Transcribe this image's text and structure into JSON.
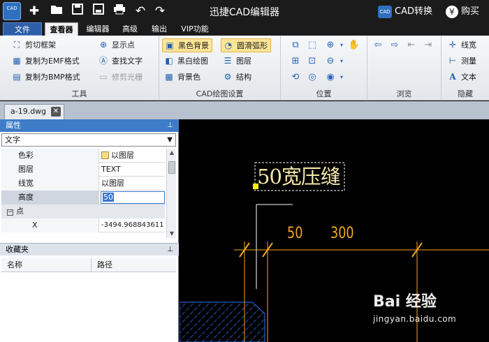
{
  "titlebar": {
    "app_logo": "CAD",
    "title": "迅捷CAD编辑器",
    "cad_convert_label": "CAD转换",
    "cad_convert_badge": "CAD",
    "buy_symbol": "¥",
    "buy_label": "购买",
    "quick_access_icons": [
      "new-icon",
      "open-icon",
      "save-icon",
      "save-as-icon",
      "print-icon",
      "undo-icon",
      "redo-icon"
    ]
  },
  "menu": {
    "tabs": [
      {
        "label": "文件"
      },
      {
        "label": "查看器"
      },
      {
        "label": "编辑器"
      },
      {
        "label": "高级"
      },
      {
        "label": "输出"
      },
      {
        "label": "VIP功能"
      }
    ],
    "active_tab": "查看器"
  },
  "ribbon": {
    "tools": {
      "label": "工具",
      "buttons": [
        "剪切框架",
        "复制为EMF格式",
        "复制为BMP格式",
        "显示点",
        "查找文字",
        "修剪光栅"
      ]
    },
    "cad_settings": {
      "label": "CAD绘图设置",
      "buttons": [
        "黑色背景",
        "黑白绘图",
        "背景色",
        "圆滑弧形",
        "图层",
        "结构"
      ]
    },
    "position": {
      "label": "位置"
    },
    "browse": {
      "label": "浏览"
    },
    "hide": {
      "label": "隐藏",
      "buttons": [
        "线宽",
        "测量",
        "文本"
      ]
    }
  },
  "document": {
    "tab_name": "a-19.dwg",
    "close_symbol": "✕"
  },
  "properties": {
    "header": "属性",
    "object_type": "文字",
    "rows": [
      {
        "name": "色彩",
        "value": "以图层"
      },
      {
        "name": "图层",
        "value": "TEXT"
      },
      {
        "name": "线宽",
        "value": "以图层"
      },
      {
        "name": "高度",
        "value": "50"
      },
      {
        "name": "点",
        "value": ""
      },
      {
        "name": "X",
        "value": "-3494.968843611"
      }
    ]
  },
  "favorites": {
    "header": "收藏夹",
    "columns": [
      "名称",
      "路径"
    ]
  },
  "drawing": {
    "main_text": "50宽压缝",
    "dim_left": "50",
    "dim_right": "300",
    "colors": {
      "text": "#f5e6a8",
      "dimension": "#f2a91e",
      "hatch": "#2f6ff0",
      "lines": "#ffffff"
    }
  },
  "watermark": {
    "brand": "Bai 经验",
    "url": "jingyan.baidu.com"
  }
}
